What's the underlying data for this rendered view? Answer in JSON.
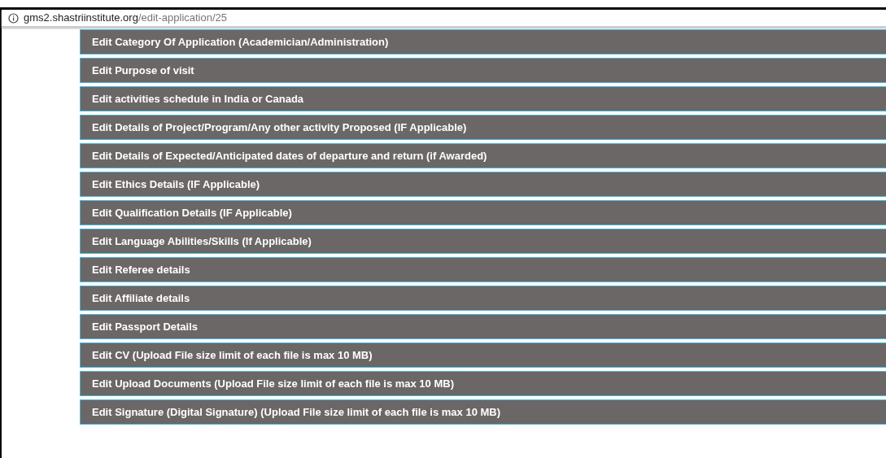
{
  "address_bar": {
    "host": "gms2.shastriinstitute.org",
    "path": "/edit-application/25"
  },
  "sections": [
    {
      "title": "Edit Category Of Application (Academician/Administration)"
    },
    {
      "title": "Edit Purpose of visit"
    },
    {
      "title": "Edit activities schedule in India or Canada"
    },
    {
      "title": "Edit Details of Project/Program/Any other activity Proposed (IF Applicable)"
    },
    {
      "title": "Edit Details of Expected/Anticipated dates of departure and return (if Awarded)"
    },
    {
      "title": "Edit Ethics Details (IF Applicable)"
    },
    {
      "title": "Edit Qualification Details (IF Applicable)"
    },
    {
      "title": "Edit Language Abilities/Skills (If Applicable)"
    },
    {
      "title": "Edit Referee details"
    },
    {
      "title": "Edit Affiliate details"
    },
    {
      "title": "Edit Passport Details"
    },
    {
      "title": "Edit CV (Upload File size limit of each file is max 10 MB)"
    },
    {
      "title": "Edit Upload Documents (Upload File size limit of each file is max 10 MB)"
    },
    {
      "title": "Edit Signature (Digital Signature) (Upload File size limit of each file is max 10 MB)"
    }
  ]
}
